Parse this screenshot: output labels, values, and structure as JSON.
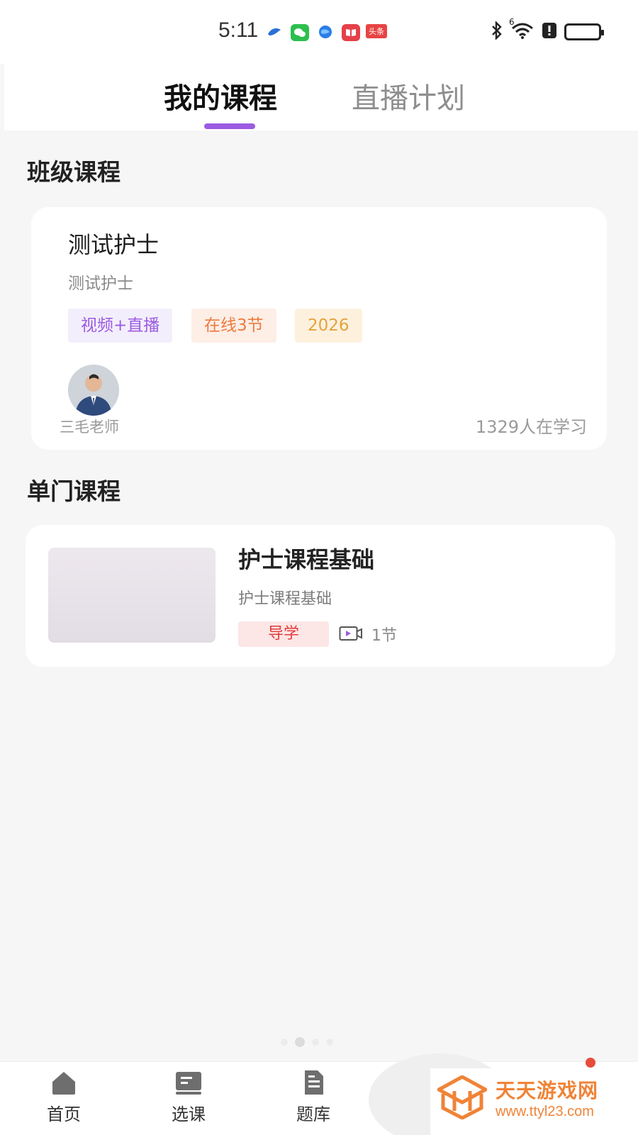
{
  "status_bar": {
    "time": "5:11",
    "app_icons": [
      "bird-icon",
      "wechat-icon",
      "globe-icon",
      "book-icon",
      "toutiao-icon"
    ],
    "toutiao_label": "头条",
    "signal_label": "6",
    "right_icons": [
      "bluetooth-icon",
      "wifi-icon",
      "alert-icon",
      "battery-icon"
    ]
  },
  "top_tabs": {
    "active": "我的课程",
    "inactive": "直播计划"
  },
  "class_section": {
    "title": "班级课程",
    "card": {
      "title": "测试护士",
      "subtitle": "测试护士",
      "tags": [
        "视频+直播",
        "在线3节",
        "2026"
      ],
      "teacher": "三毛老师",
      "learners": "1329人在学习"
    }
  },
  "single_section": {
    "title": "单门课程",
    "card": {
      "title": "护士课程基础",
      "subtitle": "护士课程基础",
      "tag": "导学",
      "lessons": "1节"
    }
  },
  "bottom_nav": {
    "items": [
      {
        "label": "首页",
        "icon": "home-icon"
      },
      {
        "label": "选课",
        "icon": "course-select-icon"
      },
      {
        "label": "题库",
        "icon": "question-bank-icon"
      }
    ]
  },
  "watermark": {
    "text": "天天游戏网",
    "url": "www.ttyl23.com"
  },
  "colors": {
    "accent": "#9c5be2",
    "tag_orange": "#ec7b3e",
    "tag_yellow": "#e6a23c",
    "tag_red": "#e03c3c",
    "watermark": "#f08337"
  }
}
